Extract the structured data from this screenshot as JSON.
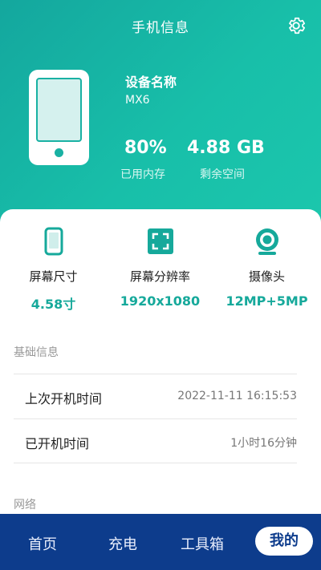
{
  "header": {
    "title": "手机信息"
  },
  "device": {
    "name_label": "设备名称",
    "model": "MX6",
    "memory_used_value": "80%",
    "memory_used_label": "已用内存",
    "storage_free_value": "4.88 GB",
    "storage_free_label": "剩余空间"
  },
  "specs": [
    {
      "label": "屏幕尺寸",
      "value": "4.58寸",
      "icon": "phone-outline-icon"
    },
    {
      "label": "屏幕分辨率",
      "value": "1920x1080",
      "icon": "fullscreen-icon"
    },
    {
      "label": "摄像头",
      "value": "12MP+5MP",
      "icon": "camera-icon"
    }
  ],
  "sections": {
    "basic": {
      "title": "基础信息",
      "rows": [
        {
          "key": "上次开机时间",
          "value": "2022-11-11 16:15:53"
        },
        {
          "key": "已开机时间",
          "value": "1小时16分钟"
        }
      ]
    },
    "network": {
      "title": "网络"
    }
  },
  "nav": {
    "items": [
      "首页",
      "充电",
      "工具箱",
      "我的"
    ],
    "active_index": 3
  },
  "colors": {
    "accent": "#18bfa9",
    "nav_bg": "#0d3c8c"
  }
}
